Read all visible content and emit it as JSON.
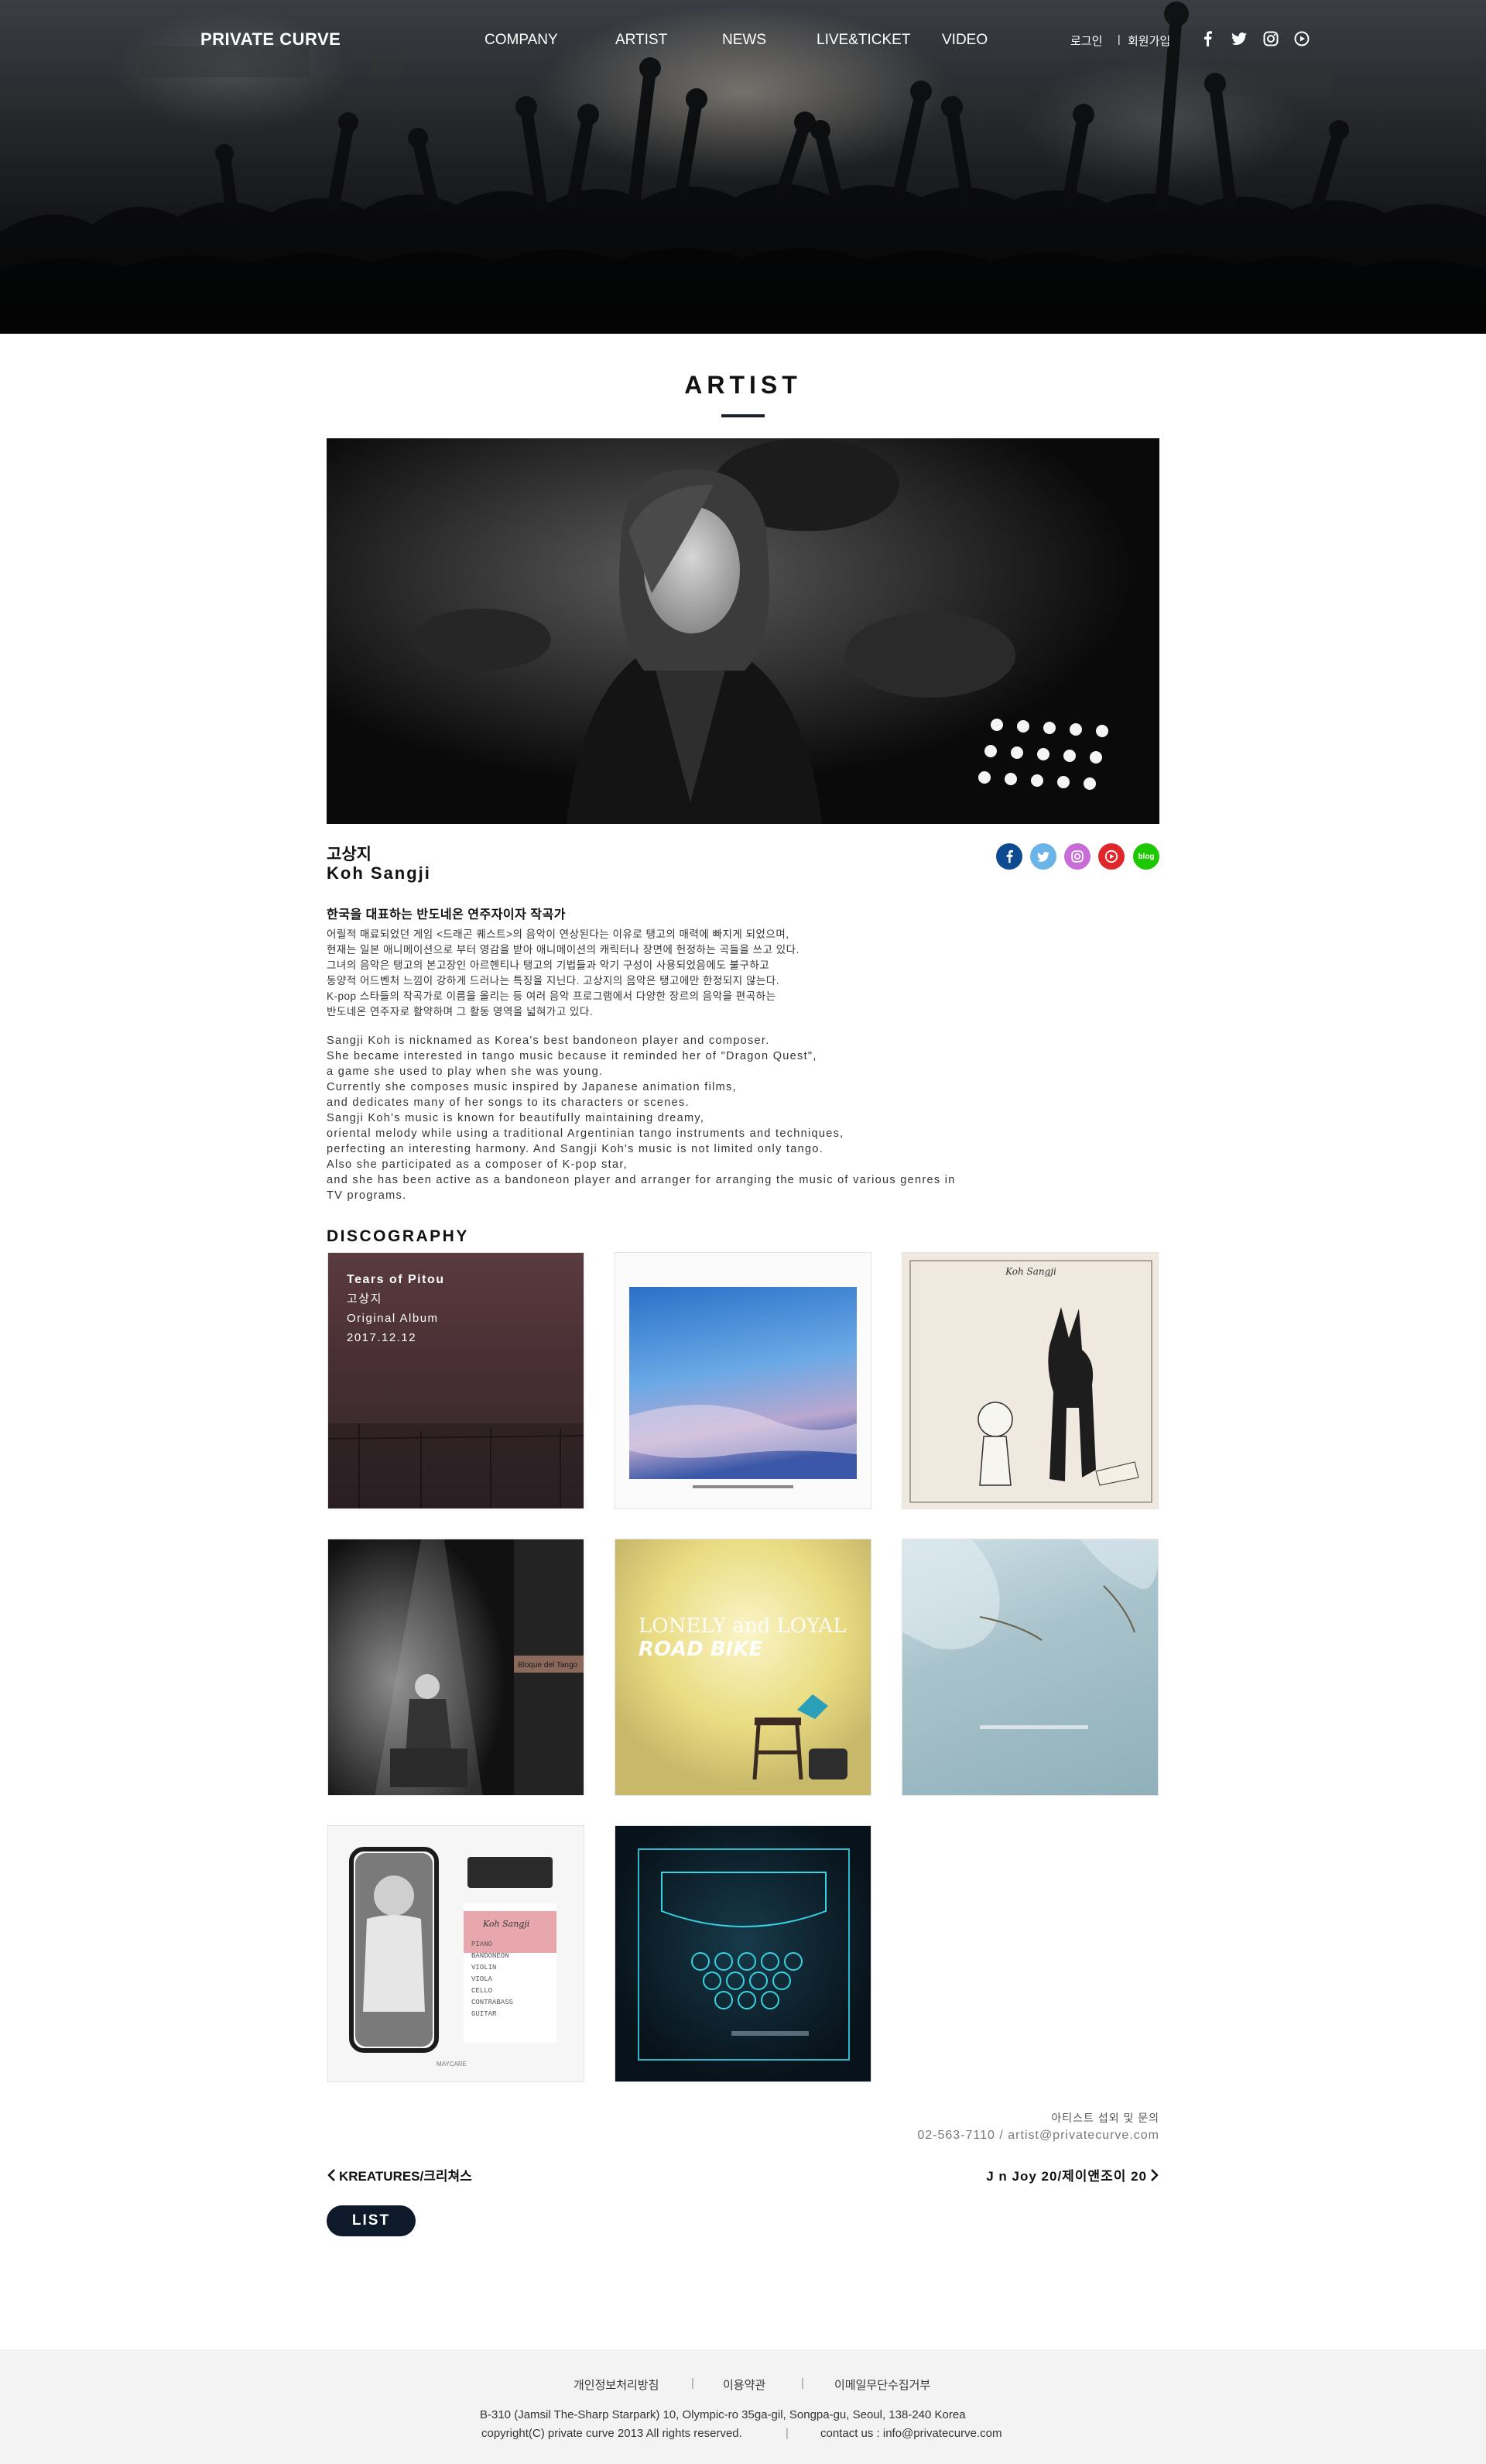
{
  "brand": {
    "logo": "PRIVATE CURVE"
  },
  "nav": {
    "items": [
      {
        "label": "COMPANY"
      },
      {
        "label": "ARTIST"
      },
      {
        "label": "NEWS"
      },
      {
        "label": "LIVE&TICKET"
      },
      {
        "label": "VIDEO"
      }
    ]
  },
  "util": {
    "login": "로그인",
    "signup": "회원가입"
  },
  "header_sns": [
    "facebook-icon",
    "twitter-icon",
    "instagram-icon",
    "play-icon"
  ],
  "page": {
    "title": "ARTIST"
  },
  "artist": {
    "name_ko": "고상지",
    "name_en": "Koh Sangji",
    "sns": [
      {
        "icon": "facebook-icon",
        "glyph": "f",
        "color": "#0d4a8f"
      },
      {
        "icon": "twitter-icon",
        "glyph": "t",
        "color": "#6ab4e8"
      },
      {
        "icon": "instagram-icon",
        "glyph": "◎",
        "color": "#c86dd7"
      },
      {
        "icon": "youtube-icon",
        "glyph": "▶",
        "color": "#e0262d"
      },
      {
        "icon": "blog-icon",
        "glyph": "blog",
        "color": "#1ec800"
      }
    ],
    "headline": "한국을 대표하는 반도네온 연주자이자 작곡가",
    "bio_ko": [
      "어릴적 매료되었던 게임 <드래곤 퀘스트>의 음악이 연상된다는 이유로 탱고의 매력에 빠지게 되었으며,",
      "현재는 일본 애니메이션으로 부터 영감을 받아 애니메이션의 캐릭터나 장면에 헌정하는 곡들을 쓰고 있다.",
      "그녀의 음악은 탱고의 본고장인 아르헨티나 탱고의 기법들과 악기 구성이 사용되었음에도 불구하고",
      "동양적 어드벤처 느낌이 강하게 드러나는 특징을 지닌다. 고상지의 음악은 탱고에만 한정되지 않는다.",
      "K-pop 스타들의 작곡가로 이름을 올리는 등 여러 음악 프로그램에서 다양한 장르의 음악을 편곡하는",
      "반도네온 연주자로 활약하며 그 활동 영역을 넓혀가고 있다."
    ],
    "bio_en": [
      "Sangji Koh is nicknamed as Korea's best bandoneon player and composer.",
      "She became interested in tango music because it reminded her of \"Dragon Quest\",",
      "a game she used to play when she was young.",
      "Currently she composes music inspired by Japanese animation films,",
      "and dedicates many of her songs to its characters or scenes.",
      "Sangji Koh's music is known for beautifully maintaining dreamy,",
      "oriental melody while using a traditional Argentinian tango instruments and techniques,",
      "perfecting an interesting harmony. And Sangji Koh's music is not limited only tango.",
      "Also she participated as a composer of K-pop star,",
      "and she has been active as a bandoneon player and arranger for arranging the music of various genres in",
      "TV programs."
    ]
  },
  "discography": {
    "title": "DISCOGRAPHY",
    "featured": {
      "title": "Tears of Pitou",
      "artist": "고상지",
      "type": "Original Album",
      "date": "2017.12.12"
    },
    "cover_texts": {
      "road_bike_1": "LONELY and LOYAL",
      "road_bike_2": "ROAD BIKE",
      "signature": "Koh Sangji",
      "maycare": "Koh Sangji",
      "maycare_list": [
        "PIANO",
        "BANDONEON",
        "VIOLIN",
        "VIOLA",
        "CELLO",
        "CONTRABASS",
        "GUITAR"
      ],
      "maycare_label": "MAYCARE",
      "bloque": "Bloque del Tango"
    }
  },
  "contact": {
    "label": "아티스트 섭외 및 문의",
    "value": "02-563-7110 / artist@privatecurve.com"
  },
  "pager": {
    "prev": "KREATURES/크리쳐스",
    "next": "J n Joy 20/제이앤조이 20"
  },
  "list_button": "LIST",
  "footer": {
    "links": [
      "개인정보처리방침",
      "이용약관",
      "이메일무단수집거부"
    ],
    "address": "B-310 (Jamsil The-Sharp Starpark) 10, Olympic-ro 35ga-gil, Songpa-gu, Seoul, 138-240 Korea",
    "copyright": "copyright(C) private curve 2013 All rights reserved.",
    "contact": "contact us : info@privatecurve.com"
  }
}
